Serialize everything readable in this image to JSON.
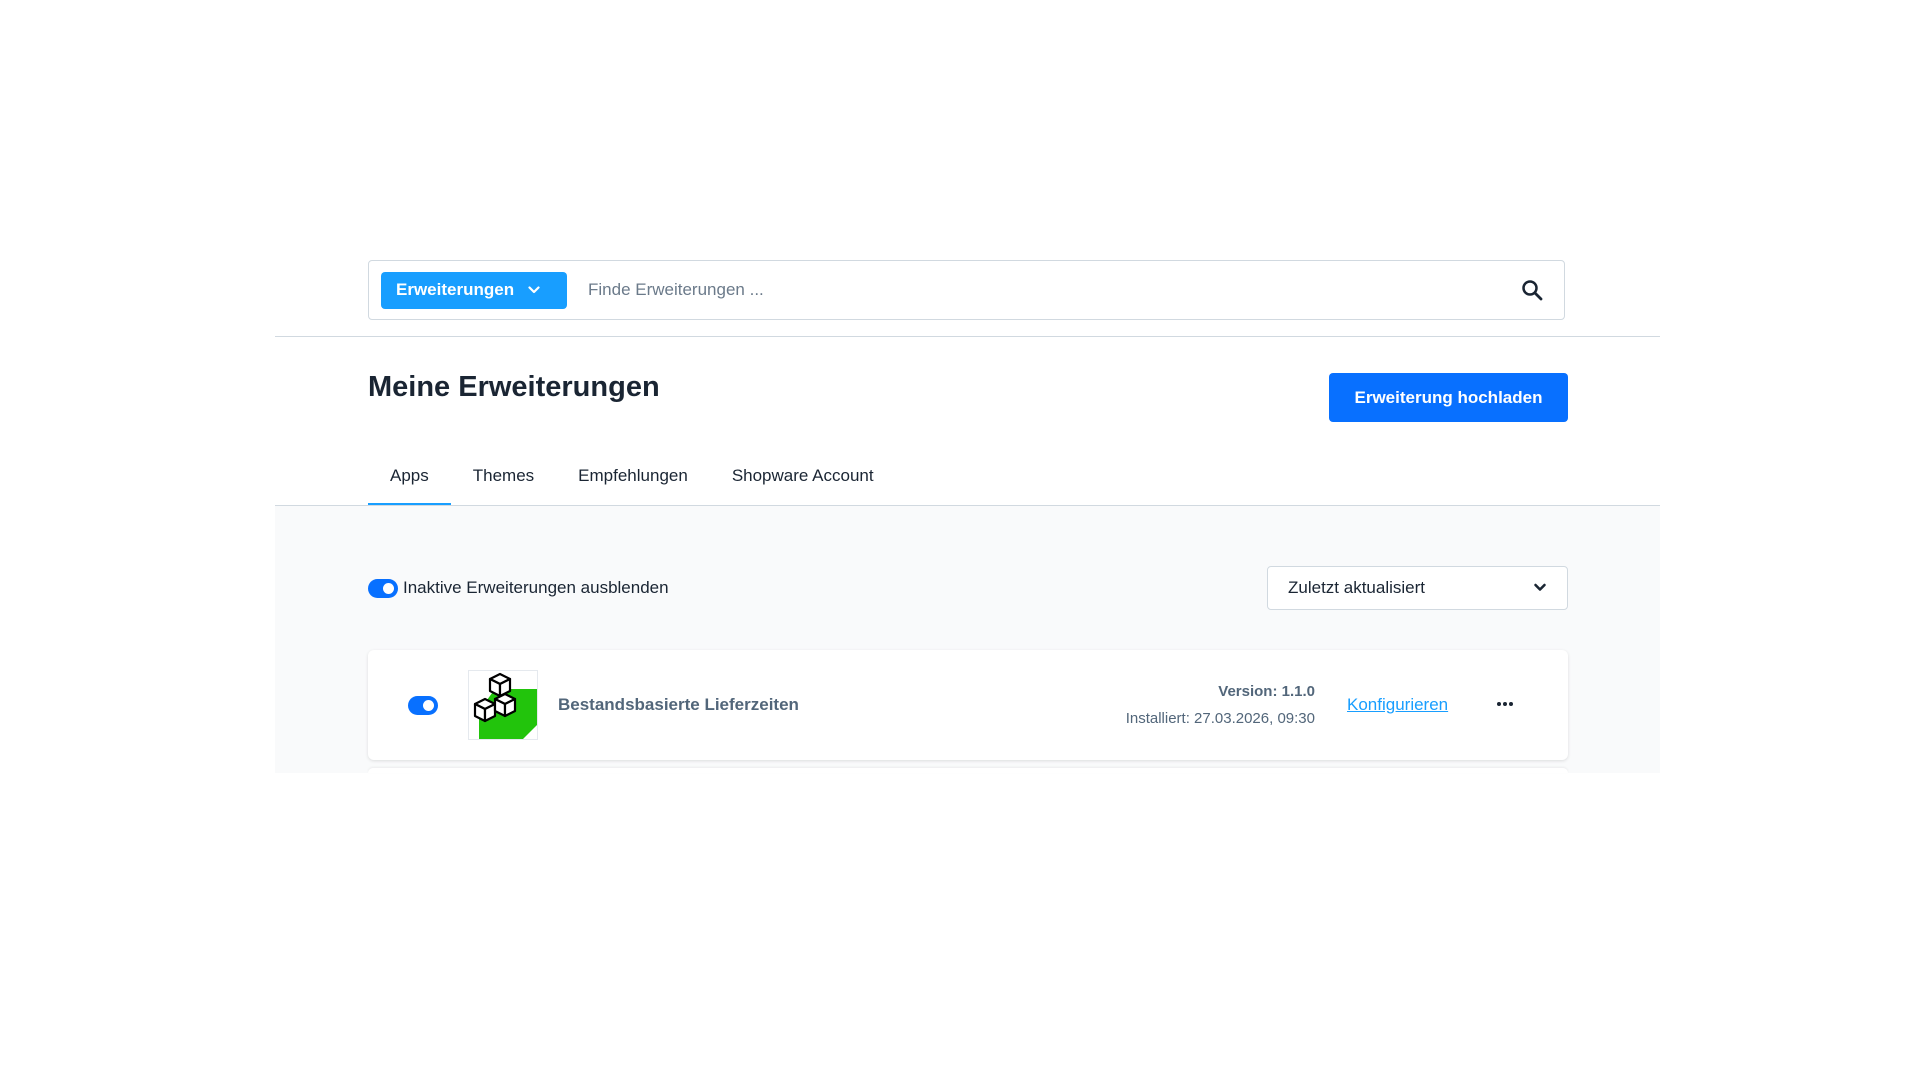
{
  "search": {
    "type_select_label": "Erweiterungen",
    "placeholder": "Finde Erweiterungen ...",
    "value": ""
  },
  "header": {
    "title": "Meine Erweiterungen",
    "upload_label": "Erweiterung hochladen"
  },
  "tabs": [
    {
      "label": "Apps",
      "active": true
    },
    {
      "label": "Themes",
      "active": false
    },
    {
      "label": "Empfehlungen",
      "active": false
    },
    {
      "label": "Shopware Account",
      "active": false
    }
  ],
  "filters": {
    "hide_inactive_label": "Inaktive Erweiterungen ausblenden",
    "hide_inactive_on": true,
    "sort_value": "Zuletzt aktualisiert"
  },
  "extensions": [
    {
      "active": true,
      "name": "Bestandsbasierte Lieferzeiten",
      "version": "Version: 1.1.0",
      "installed": "Installiert: 27.03.2026, 09:30",
      "config_label": "Konfigurieren",
      "icon": "boxes-icon"
    }
  ],
  "colors": {
    "primary": "#0870ff",
    "accent": "#189eff",
    "icon_green": "#22c40c"
  }
}
